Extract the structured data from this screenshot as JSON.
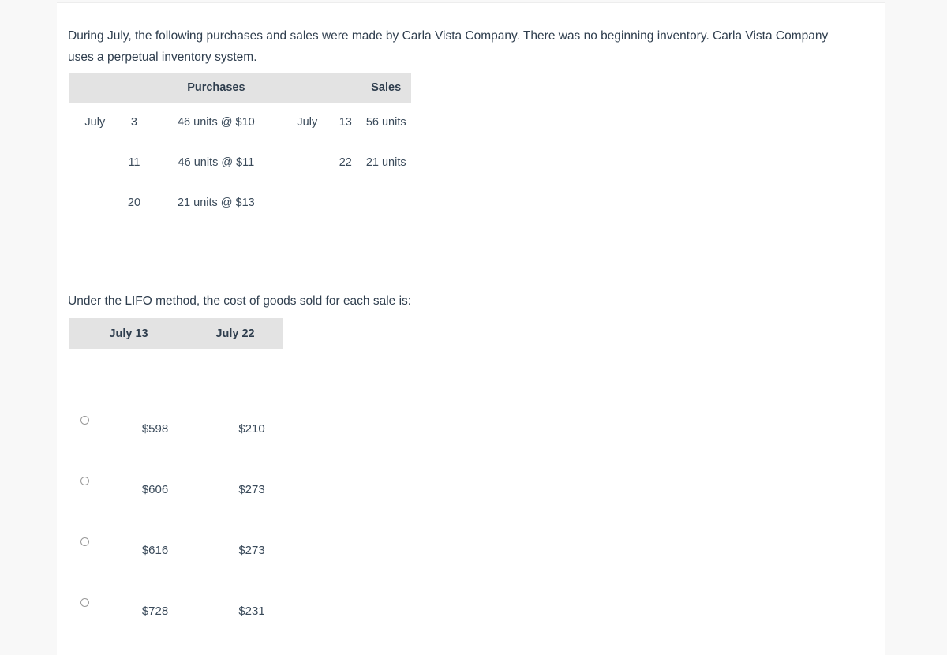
{
  "question": {
    "intro": "During July, the following purchases and sales were made by Carla Vista Company. There was no beginning inventory. Carla Vista Company uses a perpetual inventory system.",
    "prompt": "Under the LIFO method, the cost of goods sold for each sale is:"
  },
  "inventory_table": {
    "headers": {
      "blank": "",
      "purchases": "Purchases",
      "sales": "Sales"
    },
    "rows": [
      {
        "purchase_month": "July",
        "purchase_day": "3",
        "purchase_detail": "46 units @ $10",
        "sale_month": "July",
        "sale_day": "13",
        "sale_detail": "56 units"
      },
      {
        "purchase_month": "",
        "purchase_day": "11",
        "purchase_detail": "46 units @ $11",
        "sale_month": "",
        "sale_day": "22",
        "sale_detail": "21 units"
      },
      {
        "purchase_month": "",
        "purchase_day": "20",
        "purchase_detail": "21 units @ $13",
        "sale_month": "",
        "sale_day": "",
        "sale_detail": ""
      }
    ]
  },
  "answers": {
    "headers": [
      "July 13",
      "July 22"
    ],
    "options": [
      {
        "july13": "$598",
        "july22": "$210",
        "selected": false
      },
      {
        "july13": "$606",
        "july22": "$273",
        "selected": false
      },
      {
        "july13": "$616",
        "july22": "$273",
        "selected": false
      },
      {
        "july13": "$728",
        "july22": "$231",
        "selected": false
      }
    ]
  },
  "colors": {
    "page_background": "#f8f8f8",
    "card_background": "#ffffff",
    "table_header_background": "#e3e3e3",
    "text": "#2f3e4e",
    "radio_border": "#9a9a9a"
  }
}
